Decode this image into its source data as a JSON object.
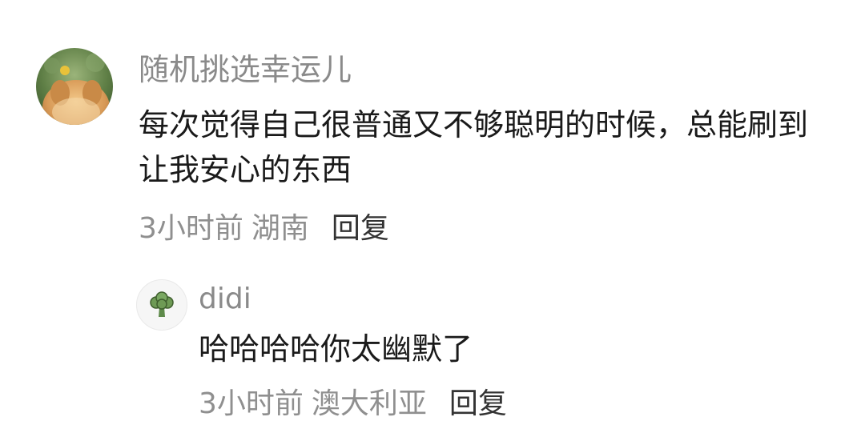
{
  "comment": {
    "avatar_icon": "dog-avatar-icon",
    "username": "随机挑选幸运儿",
    "text": "每次觉得自己很普通又不够聪明的时候，总能刷到让我安心的东西",
    "time": "3小时前",
    "location": "湖南",
    "reply_label": "回复"
  },
  "reply": {
    "avatar_icon": "broccoli-avatar-icon",
    "username": "didi",
    "text": "哈哈哈哈你太幽默了",
    "time": "3小时前",
    "location": "澳大利亚",
    "reply_label": "回复"
  },
  "colors": {
    "username": "#8a8a8a",
    "body_text": "#1a1a1a",
    "meta_text": "#8f8f8f",
    "reply_link": "#333333"
  }
}
